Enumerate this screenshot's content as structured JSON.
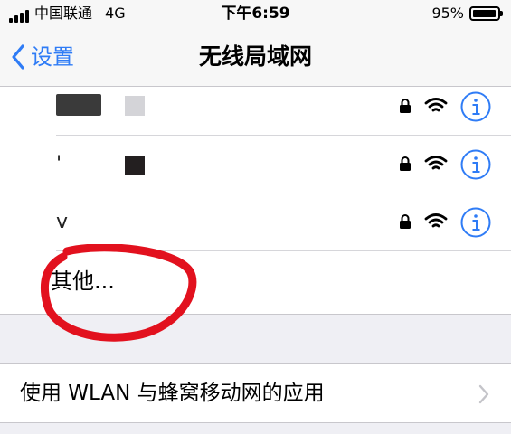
{
  "status_bar": {
    "carrier": "中国联通",
    "network_type": "4G",
    "time": "下午6:59",
    "battery_percent": "95%",
    "battery_level": 0.95
  },
  "nav": {
    "back_label": "设置",
    "title": "无线局域网"
  },
  "networks": [
    {
      "name": "",
      "secured": true
    },
    {
      "name": "'",
      "secured": true
    },
    {
      "name": "v",
      "secured": true
    }
  ],
  "other_label": "其他...",
  "apps_row": {
    "label": "使用 WLAN 与蜂窝移动网的应用"
  },
  "colors": {
    "accent": "#2f7cf6",
    "annotation": "#e2111e",
    "background": "#efeff4"
  },
  "icons": {
    "back": "chevron-left-icon",
    "lock": "lock-icon",
    "wifi": "wifi-icon",
    "info": "info-icon",
    "disclosure": "chevron-right-icon"
  }
}
